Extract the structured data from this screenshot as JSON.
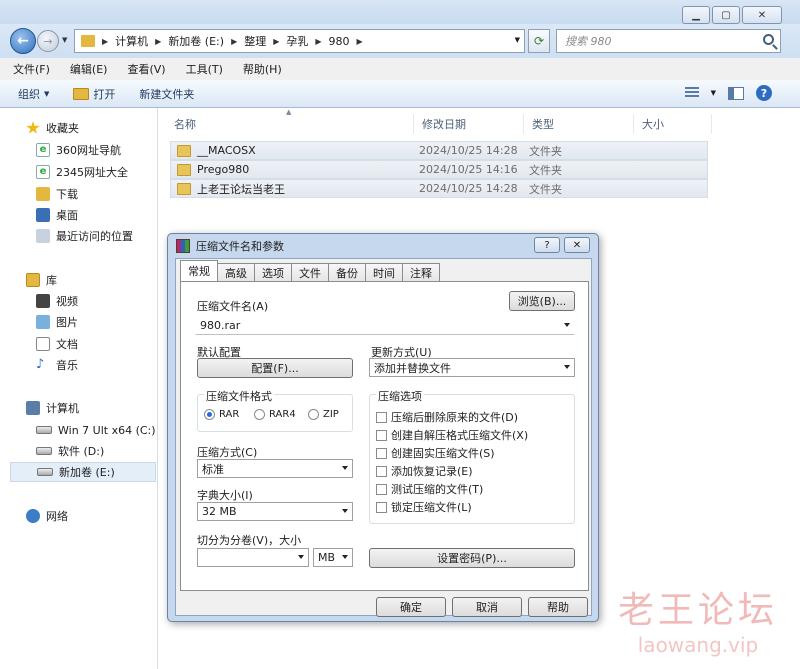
{
  "address": {
    "crumbs": [
      "计算机",
      "新加卷 (E:)",
      "整理",
      "孕乳",
      "980"
    ],
    "search_placeholder": "搜索 980"
  },
  "menubar": [
    "文件(F)",
    "编辑(E)",
    "查看(V)",
    "工具(T)",
    "帮助(H)"
  ],
  "cmdbar": {
    "organize": "组织",
    "open": "打开",
    "new_folder": "新建文件夹"
  },
  "nav": {
    "favorites": "收藏夹",
    "fav_items": [
      "360网址导航",
      "2345网址大全",
      "下载",
      "桌面",
      "最近访问的位置"
    ],
    "library": "库",
    "lib_items": [
      "视频",
      "图片",
      "文档",
      "音乐"
    ],
    "computer": "计算机",
    "drives": [
      "Win 7 Ult x64 (C:)",
      "软件 (D:)",
      "新加卷 (E:)"
    ],
    "network": "网络"
  },
  "filelist": {
    "columns": [
      "名称",
      "修改日期",
      "类型",
      "大小"
    ],
    "rows": [
      {
        "name": "__MACOSX",
        "date": "2024/10/25 14:28",
        "type": "文件夹"
      },
      {
        "name": "Prego980",
        "date": "2024/10/25 14:16",
        "type": "文件夹"
      },
      {
        "name": "上老王论坛当老王",
        "date": "2024/10/25 14:28",
        "type": "文件夹"
      }
    ]
  },
  "dialog": {
    "title": "压缩文件名和参数",
    "tabs": [
      "常规",
      "高级",
      "选项",
      "文件",
      "备份",
      "时间",
      "注释"
    ],
    "archive_name_label": "压缩文件名(A)",
    "browse": "浏览(B)...",
    "archive_name": "980.rar",
    "default_profile_label": "默认配置",
    "profiles_button": "配置(F)...",
    "update_mode_label": "更新方式(U)",
    "update_mode": "添加并替换文件",
    "format_label": "压缩文件格式",
    "formats": [
      "RAR",
      "RAR4",
      "ZIP"
    ],
    "options_label": "压缩选项",
    "options": [
      "压缩后删除原来的文件(D)",
      "创建自解压格式压缩文件(X)",
      "创建固实压缩文件(S)",
      "添加恢复记录(E)",
      "测试压缩的文件(T)",
      "锁定压缩文件(L)"
    ],
    "method_label": "压缩方式(C)",
    "method": "标准",
    "dict_label": "字典大小(I)",
    "dict": "32 MB",
    "split_label": "切分为分卷(V)，大小",
    "split_unit": "MB",
    "password_button": "设置密码(P)...",
    "ok": "确定",
    "cancel": "取消",
    "help": "帮助"
  },
  "watermark": {
    "line1": "老王论坛",
    "line2": "laowang.vip"
  }
}
